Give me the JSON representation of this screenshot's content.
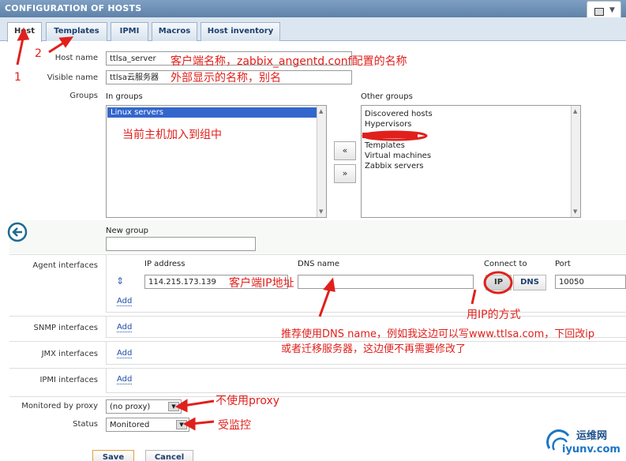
{
  "header": {
    "title": "CONFIGURATION OF HOSTS"
  },
  "tabs": [
    "Host",
    "Templates",
    "IPMI",
    "Macros",
    "Host inventory"
  ],
  "form": {
    "host_name_label": "Host name",
    "host_name_value": "ttlsa_server",
    "visible_name_label": "Visible name",
    "visible_name_value": "ttlsa云服务器",
    "groups_label": "Groups",
    "in_groups_label": "In groups",
    "other_groups_label": "Other groups",
    "in_groups": [
      "Linux servers"
    ],
    "other_groups": [
      "Discovered hosts",
      "Hypervisors",
      "",
      "Templates",
      "Virtual machines",
      "Zabbix servers"
    ],
    "move_left": "«",
    "move_right": "»",
    "new_group_label": "New group",
    "agent_interfaces_label": "Agent interfaces",
    "ip_address_label": "IP address",
    "dns_name_label": "DNS name",
    "connect_to_label": "Connect to",
    "port_label": "Port",
    "ip_value": "114.215.173.139",
    "dns_value": "",
    "connect_ip": "IP",
    "connect_dns": "DNS",
    "port_value": "10050",
    "add": "Add",
    "snmp_label": "SNMP interfaces",
    "jmx_label": "JMX interfaces",
    "ipmi_label": "IPMI interfaces",
    "proxy_label": "Monitored by proxy",
    "proxy_value": "(no proxy)",
    "status_label": "Status",
    "status_value": "Monitored",
    "save": "Save",
    "cancel": "Cancel"
  },
  "annotations": {
    "num1": "1",
    "num2": "2",
    "hostname_note": "客户端名称，zabbix_angentd.conf配置的名称",
    "visible_note": "外部显示的名称，别名",
    "group_note": "当前主机加入到组中",
    "ip_note": "客户端IP地址",
    "ip_mode_note": "用IP的方式",
    "dns_note_1": "推荐使用DNS name，例如我这边可以写www.ttlsa.com，下回改ip",
    "dns_note_2": "或者迁移服务器，这边便不再需要修改了",
    "proxy_note": "不使用proxy",
    "status_note": "受监控"
  },
  "watermark": {
    "name": "运维网",
    "url": "iyunv.com"
  },
  "colors": {
    "annotation": "#e0201c",
    "header": "#6f92b8",
    "link": "#1f4ea5"
  }
}
